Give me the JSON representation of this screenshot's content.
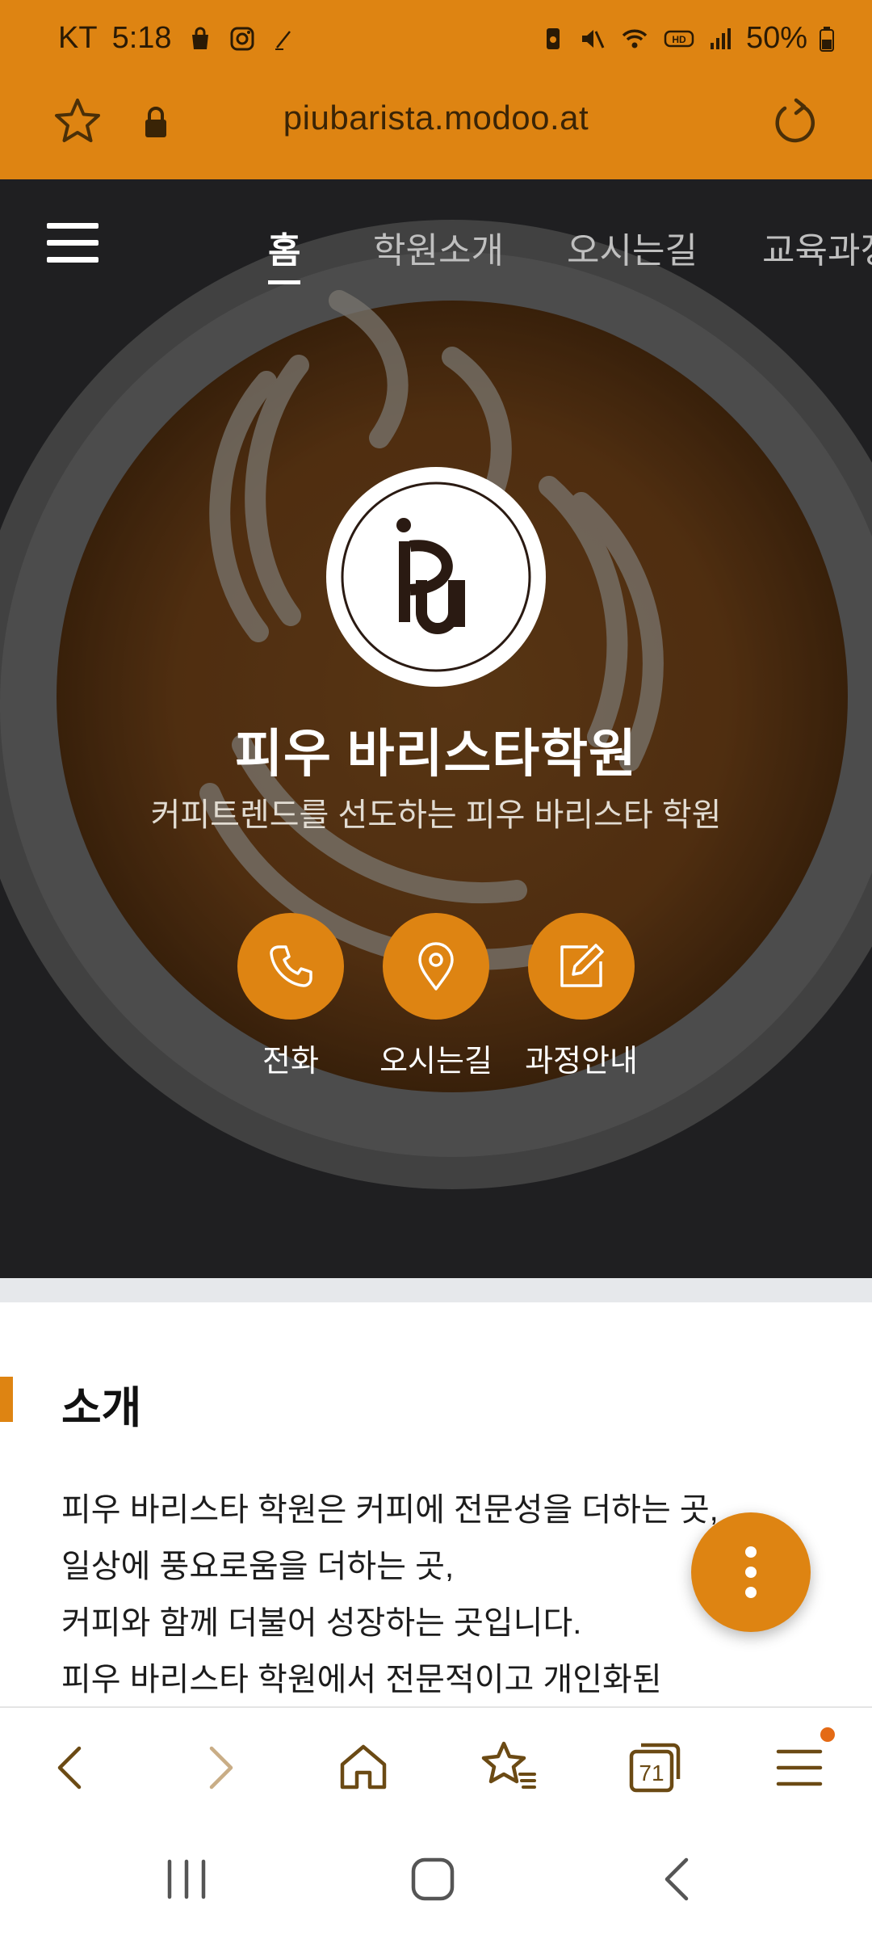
{
  "status_bar": {
    "carrier": "KT",
    "time": "5:18",
    "battery": "50%",
    "left_icons": [
      "shopping-bag-icon",
      "instagram-icon",
      "pen-icon"
    ],
    "right_icons": [
      "battery-saver-icon",
      "mute-icon",
      "wifi-icon",
      "hd-icon",
      "signal-icon",
      "battery-icon"
    ]
  },
  "address_bar": {
    "url": "piubarista.modoo.at"
  },
  "site_nav": {
    "tabs": [
      {
        "label": "홈",
        "active": true
      },
      {
        "label": "학원소개",
        "active": false
      },
      {
        "label": "오시는길",
        "active": false
      },
      {
        "label": "교육과정",
        "active": false
      }
    ]
  },
  "hero": {
    "title": "피우 바리스타학원",
    "subtitle": "커피트렌드를 선도하는 피우 바리스타 학원",
    "actions": [
      {
        "label": "전화",
        "icon": "phone-icon"
      },
      {
        "label": "오시는길",
        "icon": "location-pin-icon"
      },
      {
        "label": "과정안내",
        "icon": "edit-icon"
      }
    ]
  },
  "intro": {
    "heading": "소개",
    "lines": [
      "피우 바리스타 학원은 커피에 전문성을 더하는 곳,",
      "일상에 풍요로움을 더하는 곳,",
      "커피와 함께 더불어 성장하는 곳입니다.",
      "피우 바리스타 학원에서 전문적이고 개인화된"
    ]
  },
  "browser_toolbar": {
    "tab_count": "71",
    "buttons": [
      "back-icon",
      "forward-icon",
      "home-icon",
      "bookmarks-icon",
      "tabs-icon",
      "menu-icon"
    ]
  },
  "colors": {
    "accent": "#DE8412",
    "notification_dot": "#E46A15"
  }
}
